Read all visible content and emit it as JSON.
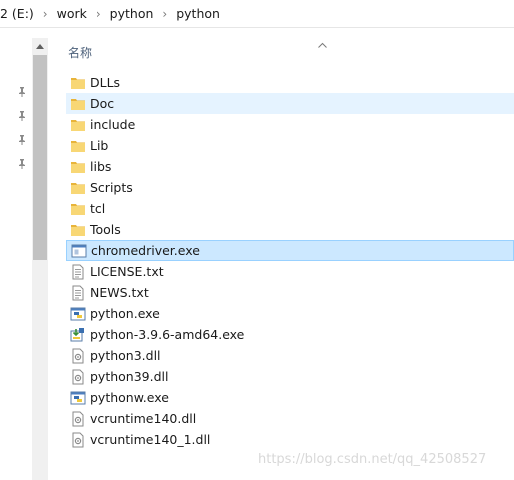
{
  "breadcrumb": {
    "drive": "2 (E:)",
    "items": [
      "work",
      "python",
      "python"
    ]
  },
  "column": {
    "name_header": "名称"
  },
  "files": [
    {
      "name": "DLLs",
      "type": "folder-icon"
    },
    {
      "name": "Doc",
      "type": "folder-icon",
      "state": "hover"
    },
    {
      "name": "include",
      "type": "folder-icon"
    },
    {
      "name": "Lib",
      "type": "folder-icon"
    },
    {
      "name": "libs",
      "type": "folder-icon"
    },
    {
      "name": "Scripts",
      "type": "folder-icon"
    },
    {
      "name": "tcl",
      "type": "folder-icon"
    },
    {
      "name": "Tools",
      "type": "folder-icon"
    },
    {
      "name": "chromedriver.exe",
      "type": "exe-icon",
      "state": "selected"
    },
    {
      "name": "LICENSE.txt",
      "type": "text-file-icon"
    },
    {
      "name": "NEWS.txt",
      "type": "text-file-icon"
    },
    {
      "name": "python.exe",
      "type": "python-exe-icon"
    },
    {
      "name": "python-3.9.6-amd64.exe",
      "type": "installer-icon"
    },
    {
      "name": "python3.dll",
      "type": "dll-icon"
    },
    {
      "name": "python39.dll",
      "type": "dll-icon"
    },
    {
      "name": "pythonw.exe",
      "type": "python-exe-icon"
    },
    {
      "name": "vcruntime140.dll",
      "type": "dll-icon"
    },
    {
      "name": "vcruntime140_1.dll",
      "type": "dll-icon"
    }
  ],
  "watermark": "https://blog.csdn.net/qq_42508527",
  "colors": {
    "hover": "#e5f3ff",
    "selected": "#cce8ff",
    "selected_border": "#99d1ff",
    "folder": "#f8d775",
    "header_text": "#4c607a"
  }
}
